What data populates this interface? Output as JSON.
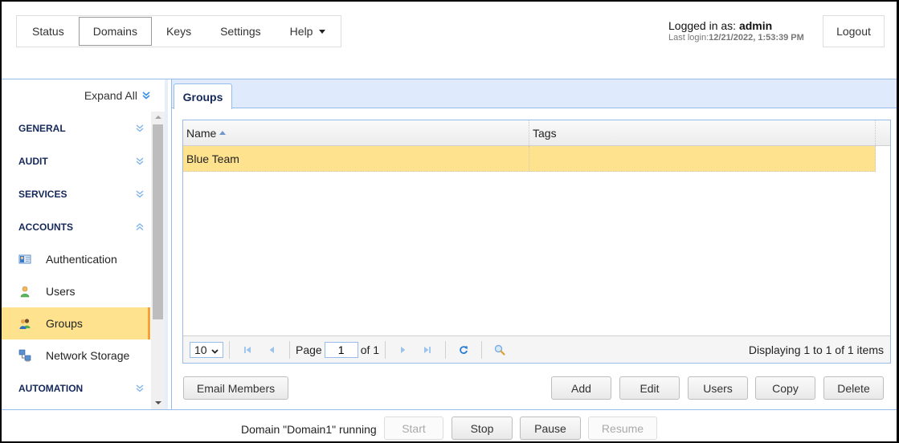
{
  "nav": {
    "items": [
      {
        "label": "Status",
        "active": false
      },
      {
        "label": "Domains",
        "active": true
      },
      {
        "label": "Keys",
        "active": false
      },
      {
        "label": "Settings",
        "active": false
      },
      {
        "label": "Help",
        "active": false,
        "has_dropdown": true
      }
    ]
  },
  "user": {
    "logged_in_prefix": "Logged in as: ",
    "username": "admin",
    "last_login_prefix": "Last login:",
    "last_login": "12/21/2022, 1:53:39 PM",
    "logout_label": "Logout"
  },
  "sidebar": {
    "expand_all_label": "Expand All",
    "expand_all_icon": "double-chevron-down-icon",
    "sections": [
      {
        "label": "GENERAL",
        "expanded": false,
        "icon": "double-chevron-down-icon"
      },
      {
        "label": "AUDIT",
        "expanded": false,
        "icon": "double-chevron-down-icon"
      },
      {
        "label": "SERVICES",
        "expanded": false,
        "icon": "double-chevron-down-icon"
      },
      {
        "label": "ACCOUNTS",
        "expanded": true,
        "icon": "double-chevron-up-icon",
        "items": [
          {
            "label": "Authentication",
            "icon": "id-card-icon",
            "selected": false
          },
          {
            "label": "Users",
            "icon": "user-icon",
            "selected": false
          },
          {
            "label": "Groups",
            "icon": "group-icon",
            "selected": true
          },
          {
            "label": "Network Storage",
            "icon": "network-storage-icon",
            "selected": false
          }
        ]
      },
      {
        "label": "AUTOMATION",
        "expanded": false,
        "icon": "double-chevron-down-icon"
      }
    ]
  },
  "content": {
    "tab_label": "Groups",
    "grid": {
      "columns": [
        {
          "label": "Name",
          "sort": "asc"
        },
        {
          "label": "Tags"
        }
      ],
      "rows": [
        {
          "name": "Blue Team",
          "tags": "",
          "selected": true
        }
      ]
    },
    "pager": {
      "page_size": "10",
      "page_label": "Page",
      "current_page": "1",
      "of_label": "of 1",
      "display_text": "Displaying 1 to 1 of 1 items"
    },
    "buttons": {
      "email_members": "Email Members",
      "add": "Add",
      "edit": "Edit",
      "users": "Users",
      "copy": "Copy",
      "delete": "Delete"
    }
  },
  "footer": {
    "status": "Domain \"Domain1\" running",
    "start": "Start",
    "stop": "Stop",
    "pause": "Pause",
    "resume": "Resume"
  },
  "colors": {
    "accent_blue": "#99bbe8",
    "tab_strip_bg": "#dfebfc",
    "selected_row": "#fee28e",
    "selected_marker": "#f7a034",
    "section_text": "#15285a",
    "icon_blue": "#3a8ee6"
  }
}
